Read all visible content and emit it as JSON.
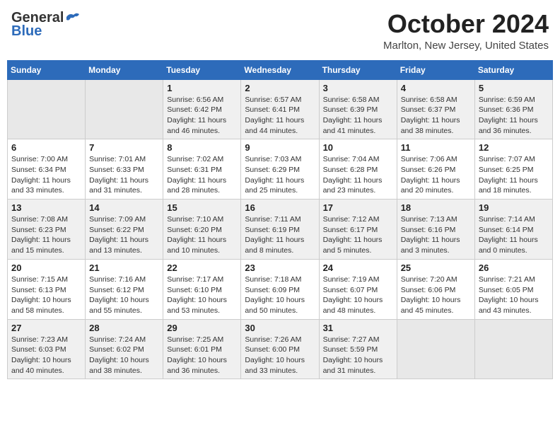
{
  "header": {
    "logo_general": "General",
    "logo_blue": "Blue",
    "month": "October 2024",
    "location": "Marlton, New Jersey, United States"
  },
  "weekdays": [
    "Sunday",
    "Monday",
    "Tuesday",
    "Wednesday",
    "Thursday",
    "Friday",
    "Saturday"
  ],
  "weeks": [
    [
      {
        "day": "",
        "info": ""
      },
      {
        "day": "",
        "info": ""
      },
      {
        "day": "1",
        "info": "Sunrise: 6:56 AM\nSunset: 6:42 PM\nDaylight: 11 hours\nand 46 minutes."
      },
      {
        "day": "2",
        "info": "Sunrise: 6:57 AM\nSunset: 6:41 PM\nDaylight: 11 hours\nand 44 minutes."
      },
      {
        "day": "3",
        "info": "Sunrise: 6:58 AM\nSunset: 6:39 PM\nDaylight: 11 hours\nand 41 minutes."
      },
      {
        "day": "4",
        "info": "Sunrise: 6:58 AM\nSunset: 6:37 PM\nDaylight: 11 hours\nand 38 minutes."
      },
      {
        "day": "5",
        "info": "Sunrise: 6:59 AM\nSunset: 6:36 PM\nDaylight: 11 hours\nand 36 minutes."
      }
    ],
    [
      {
        "day": "6",
        "info": "Sunrise: 7:00 AM\nSunset: 6:34 PM\nDaylight: 11 hours\nand 33 minutes."
      },
      {
        "day": "7",
        "info": "Sunrise: 7:01 AM\nSunset: 6:33 PM\nDaylight: 11 hours\nand 31 minutes."
      },
      {
        "day": "8",
        "info": "Sunrise: 7:02 AM\nSunset: 6:31 PM\nDaylight: 11 hours\nand 28 minutes."
      },
      {
        "day": "9",
        "info": "Sunrise: 7:03 AM\nSunset: 6:29 PM\nDaylight: 11 hours\nand 25 minutes."
      },
      {
        "day": "10",
        "info": "Sunrise: 7:04 AM\nSunset: 6:28 PM\nDaylight: 11 hours\nand 23 minutes."
      },
      {
        "day": "11",
        "info": "Sunrise: 7:06 AM\nSunset: 6:26 PM\nDaylight: 11 hours\nand 20 minutes."
      },
      {
        "day": "12",
        "info": "Sunrise: 7:07 AM\nSunset: 6:25 PM\nDaylight: 11 hours\nand 18 minutes."
      }
    ],
    [
      {
        "day": "13",
        "info": "Sunrise: 7:08 AM\nSunset: 6:23 PM\nDaylight: 11 hours\nand 15 minutes."
      },
      {
        "day": "14",
        "info": "Sunrise: 7:09 AM\nSunset: 6:22 PM\nDaylight: 11 hours\nand 13 minutes."
      },
      {
        "day": "15",
        "info": "Sunrise: 7:10 AM\nSunset: 6:20 PM\nDaylight: 11 hours\nand 10 minutes."
      },
      {
        "day": "16",
        "info": "Sunrise: 7:11 AM\nSunset: 6:19 PM\nDaylight: 11 hours\nand 8 minutes."
      },
      {
        "day": "17",
        "info": "Sunrise: 7:12 AM\nSunset: 6:17 PM\nDaylight: 11 hours\nand 5 minutes."
      },
      {
        "day": "18",
        "info": "Sunrise: 7:13 AM\nSunset: 6:16 PM\nDaylight: 11 hours\nand 3 minutes."
      },
      {
        "day": "19",
        "info": "Sunrise: 7:14 AM\nSunset: 6:14 PM\nDaylight: 11 hours\nand 0 minutes."
      }
    ],
    [
      {
        "day": "20",
        "info": "Sunrise: 7:15 AM\nSunset: 6:13 PM\nDaylight: 10 hours\nand 58 minutes."
      },
      {
        "day": "21",
        "info": "Sunrise: 7:16 AM\nSunset: 6:12 PM\nDaylight: 10 hours\nand 55 minutes."
      },
      {
        "day": "22",
        "info": "Sunrise: 7:17 AM\nSunset: 6:10 PM\nDaylight: 10 hours\nand 53 minutes."
      },
      {
        "day": "23",
        "info": "Sunrise: 7:18 AM\nSunset: 6:09 PM\nDaylight: 10 hours\nand 50 minutes."
      },
      {
        "day": "24",
        "info": "Sunrise: 7:19 AM\nSunset: 6:07 PM\nDaylight: 10 hours\nand 48 minutes."
      },
      {
        "day": "25",
        "info": "Sunrise: 7:20 AM\nSunset: 6:06 PM\nDaylight: 10 hours\nand 45 minutes."
      },
      {
        "day": "26",
        "info": "Sunrise: 7:21 AM\nSunset: 6:05 PM\nDaylight: 10 hours\nand 43 minutes."
      }
    ],
    [
      {
        "day": "27",
        "info": "Sunrise: 7:23 AM\nSunset: 6:03 PM\nDaylight: 10 hours\nand 40 minutes."
      },
      {
        "day": "28",
        "info": "Sunrise: 7:24 AM\nSunset: 6:02 PM\nDaylight: 10 hours\nand 38 minutes."
      },
      {
        "day": "29",
        "info": "Sunrise: 7:25 AM\nSunset: 6:01 PM\nDaylight: 10 hours\nand 36 minutes."
      },
      {
        "day": "30",
        "info": "Sunrise: 7:26 AM\nSunset: 6:00 PM\nDaylight: 10 hours\nand 33 minutes."
      },
      {
        "day": "31",
        "info": "Sunrise: 7:27 AM\nSunset: 5:59 PM\nDaylight: 10 hours\nand 31 minutes."
      },
      {
        "day": "",
        "info": ""
      },
      {
        "day": "",
        "info": ""
      }
    ]
  ]
}
